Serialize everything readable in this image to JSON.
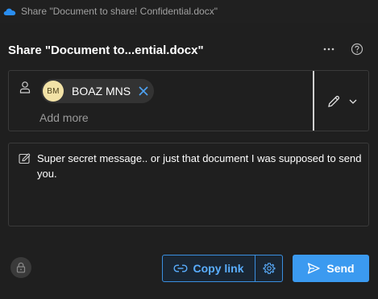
{
  "window": {
    "title": "Share \"Document to share! Confidential.docx\"",
    "app_icon": "onedrive-cloud-icon"
  },
  "header": {
    "title": "Share \"Document to...ential.docx\"",
    "more_icon": "more-options-icon",
    "help_icon": "help-icon"
  },
  "recipients": {
    "icon": "person-icon",
    "chips": [
      {
        "initials": "BM",
        "name": "BOAZ MNS",
        "remove_icon": "close-icon"
      }
    ],
    "add_placeholder": "Add more",
    "permission": {
      "icon": "pencil-icon",
      "dropdown_icon": "chevron-down-icon"
    }
  },
  "message": {
    "icon": "edit-message-icon",
    "text": "Super secret message.. or just that document I was supposed to send you."
  },
  "footer": {
    "lock_icon": "lock-icon",
    "copy_link_label": "Copy link",
    "link_icon": "link-icon",
    "settings_icon": "gear-icon",
    "send_label": "Send",
    "send_icon": "send-icon"
  },
  "colors": {
    "background": "#1f1f1f",
    "accent": "#3b9af0",
    "accent_text": "#5aaeff",
    "avatar_bg": "#f2e2a6",
    "border": "#3a3a3a"
  }
}
